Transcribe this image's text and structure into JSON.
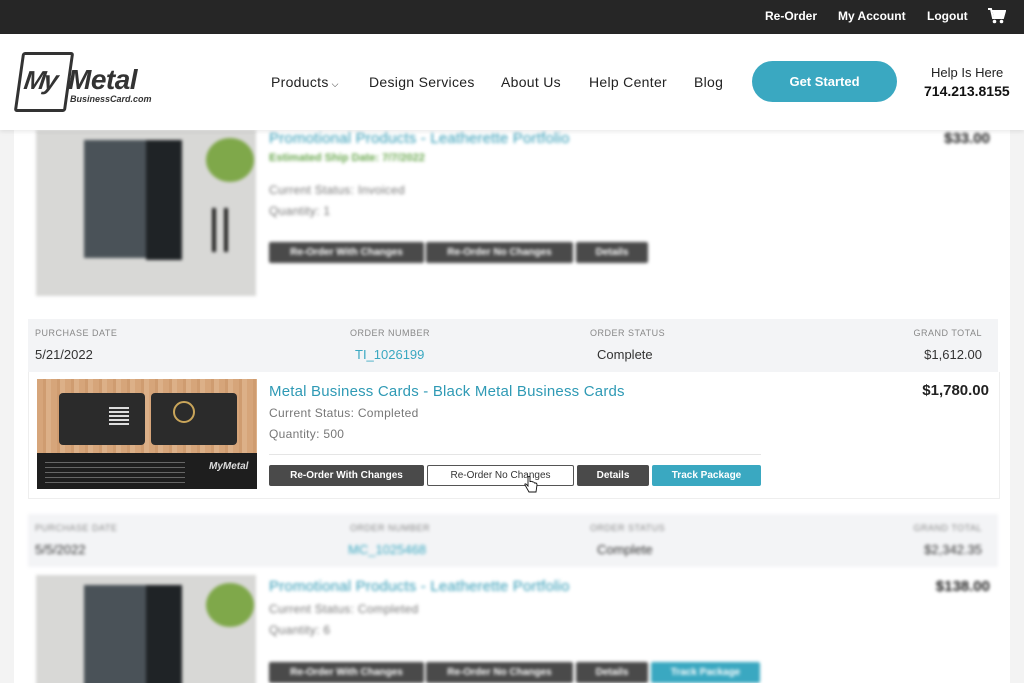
{
  "topbar": {
    "reorder": "Re-Order",
    "account": "My Account",
    "logout": "Logout",
    "cart_icon": "cart-icon"
  },
  "header": {
    "logo_my": "My",
    "logo_metal": "Metal",
    "logo_sub": "BusinessCard.com",
    "nav": {
      "products": "Products",
      "design": "Design Services",
      "about": "About Us",
      "help": "Help Center",
      "blog": "Blog"
    },
    "cta": "Get Started",
    "help_label": "Help Is Here",
    "phone": "714.213.8155"
  },
  "header_labels": {
    "purchase_date": "PURCHASE DATE",
    "order_number": "ORDER NUMBER",
    "order_status": "ORDER STATUS",
    "grand_total": "GRAND TOTAL"
  },
  "buttons": {
    "reorder_changes": "Re-Order With Changes",
    "reorder_no_changes": "Re-Order No Changes",
    "details": "Details",
    "track": "Track Package"
  },
  "orders": [
    {
      "item": {
        "title": "Promotional Products - Leatherette Portfolio",
        "ship_date": "Estimated Ship Date: 7/7/2022",
        "status": "Current Status: Invoiced",
        "quantity": "Quantity: 1",
        "price": "$33.00"
      }
    },
    {
      "purchase_date": "5/21/2022",
      "order_number": "TI_1026199",
      "order_status": "Complete",
      "grand_total": "$1,612.00",
      "item": {
        "title": "Metal Business Cards - Black Metal Business Cards",
        "status": "Current Status: Completed",
        "quantity": "Quantity: 500",
        "price": "$1,780.00"
      }
    },
    {
      "purchase_date": "5/5/2022",
      "order_number": "MC_1025468",
      "order_status": "Complete",
      "grand_total": "$2,342.35",
      "item": {
        "title": "Promotional Products - Leatherette Portfolio",
        "status": "Current Status: Completed",
        "quantity": "Quantity: 6",
        "price": "$138.00"
      }
    }
  ],
  "colors": {
    "accent": "#3aa8c1",
    "topbar": "#262626",
    "button_dark": "#4a4a4a"
  }
}
